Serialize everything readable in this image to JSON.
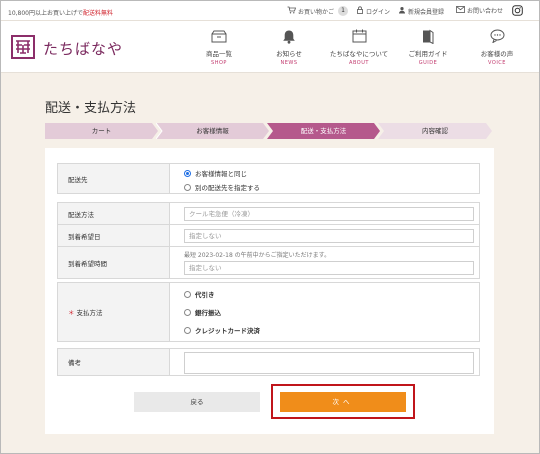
{
  "topbar": {
    "promo_prefix": "10,800円以上お買い上げで",
    "promo_highlight": "配送料無料",
    "cart_label": "お買い物かご",
    "cart_count": "1",
    "login_label": "ログイン",
    "register_label": "新規会員登録",
    "contact_label": "お問い合わせ"
  },
  "header": {
    "logo_text": "たちばなや",
    "nav": [
      {
        "label": "商品一覧",
        "sub": "SHOP"
      },
      {
        "label": "お知らせ",
        "sub": "NEWS"
      },
      {
        "label": "たちばなやについて",
        "sub": "ABOUT"
      },
      {
        "label": "ご利用ガイド",
        "sub": "GUIDE"
      },
      {
        "label": "お客様の声",
        "sub": "VOICE"
      }
    ]
  },
  "page": {
    "title": "配送・支払方法"
  },
  "steps": [
    {
      "label": "カート",
      "state": "done"
    },
    {
      "label": "お客様情報",
      "state": "done"
    },
    {
      "label": "配送・支払方法",
      "state": "current"
    },
    {
      "label": "内容確認",
      "state": "todo"
    }
  ],
  "form": {
    "destination": {
      "label": "配送先",
      "options": [
        {
          "label": "お客様情報と同じ",
          "selected": true
        },
        {
          "label": "別の配送先を指定する",
          "selected": false
        }
      ]
    },
    "shipping_method": {
      "label": "配送方法",
      "placeholder": "クール宅急便（冷凍）"
    },
    "delivery_date": {
      "label": "到着希望日",
      "placeholder": "指定しない"
    },
    "delivery_time": {
      "label": "到着希望時間",
      "note": "最短 2023-02-18 の午前中からご指定いただけます。",
      "placeholder": "指定しない"
    },
    "payment": {
      "label": "支払方法",
      "required_mark": "＊",
      "options": [
        {
          "label": "代引き",
          "selected": false
        },
        {
          "label": "銀行振込",
          "selected": false
        },
        {
          "label": "クレジットカード決済",
          "selected": false
        }
      ]
    },
    "remarks": {
      "label": "備考",
      "value": ""
    }
  },
  "buttons": {
    "back": "戻る",
    "next": "次へ"
  },
  "colors": {
    "brand": "#7b2a5f",
    "step_done": "#e3cbd8",
    "step_current": "#b5598c",
    "step_todo": "#ecdde5",
    "next_button": "#f08d1a",
    "highlight": "#c0151b"
  }
}
